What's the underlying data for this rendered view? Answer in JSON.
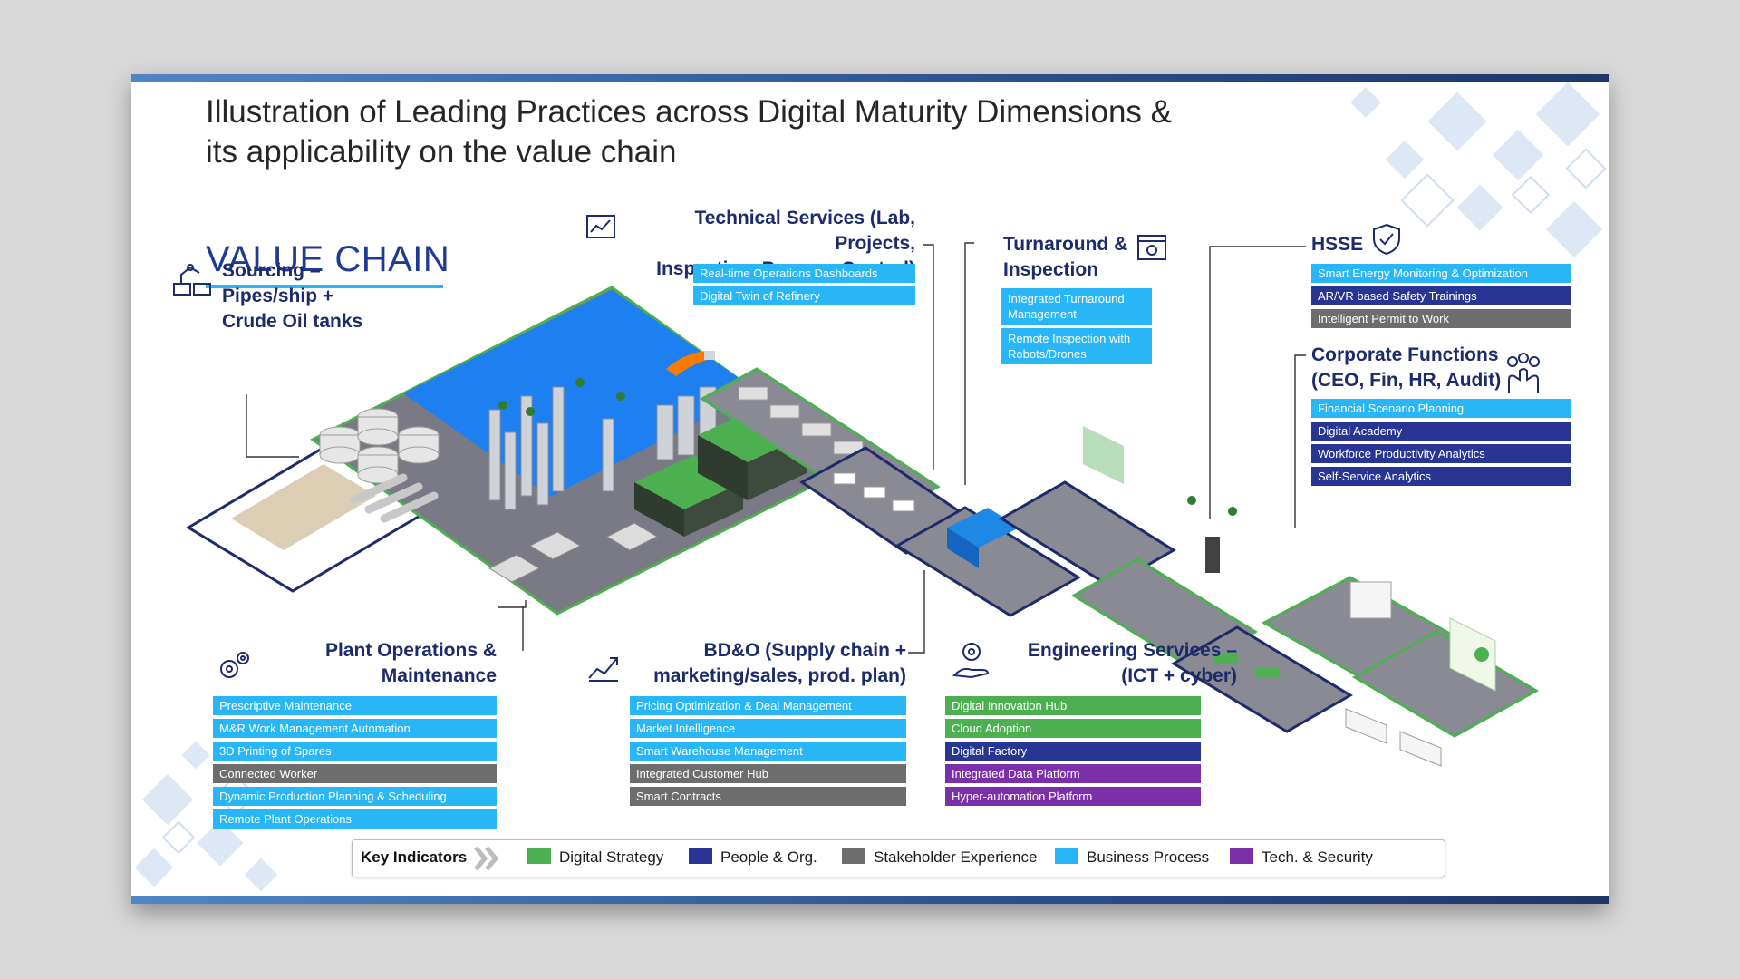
{
  "title_line1": "Illustration of Leading Practices across Digital Maturity Dimensions &",
  "title_line2": "its applicability on the value chain",
  "value_chain_label": "VALUE CHAIN",
  "colors": {
    "digital_strategy": "#4caf50",
    "people_org": "#283593",
    "stakeholder_experience": "#6d6d6d",
    "business_process": "#29b6f6",
    "tech_security": "#7b2fa8",
    "heading": "#1c2b6b"
  },
  "sections": {
    "sourcing": {
      "icon": "robot-arm-factory-icon",
      "title": [
        "Sourcing –",
        "Pipes/ship +",
        "Crude Oil tanks"
      ]
    },
    "technical": {
      "icon": "dashboard-report-icon",
      "title": [
        "Technical Services (Lab, Projects,",
        "Inspection, Process Control)"
      ],
      "items": [
        {
          "label": "Real-time Operations Dashboards",
          "category": "business_process"
        },
        {
          "label": "Digital Twin of Refinery",
          "category": "business_process"
        }
      ]
    },
    "turnaround": {
      "icon": "calendar-gear-icon",
      "title": [
        "Turnaround &",
        "Inspection"
      ],
      "items": [
        {
          "label": "Integrated Turnaround Management",
          "category": "business_process"
        },
        {
          "label": "Remote Inspection with Robots/Drones",
          "category": "business_process"
        }
      ]
    },
    "hsse": {
      "icon": "shield-check-icon",
      "title": [
        "HSSE"
      ],
      "items": [
        {
          "label": "Smart Energy Monitoring & Optimization",
          "category": "business_process"
        },
        {
          "label": "AR/VR based Safety Trainings",
          "category": "people_org"
        },
        {
          "label": "Intelligent Permit to Work",
          "category": "stakeholder_experience"
        }
      ]
    },
    "corporate": {
      "icon": "network-hand-icon",
      "title": [
        "Corporate Functions",
        "(CEO, Fin, HR, Audit)"
      ],
      "items": [
        {
          "label": "Financial Scenario Planning",
          "category": "business_process"
        },
        {
          "label": "Digital Academy",
          "category": "people_org"
        },
        {
          "label": "Workforce Productivity Analytics",
          "category": "people_org"
        },
        {
          "label": "Self-Service Analytics",
          "category": "people_org"
        }
      ]
    },
    "plant": {
      "icon": "gears-icon",
      "title": [
        "Plant Operations &",
        "Maintenance"
      ],
      "items": [
        {
          "label": "Prescriptive Maintenance",
          "category": "business_process"
        },
        {
          "label": "M&R Work Management Automation",
          "category": "business_process"
        },
        {
          "label": "3D Printing of Spares",
          "category": "business_process"
        },
        {
          "label": "Connected Worker",
          "category": "stakeholder_experience"
        },
        {
          "label": "Dynamic Production Planning & Scheduling",
          "category": "business_process"
        },
        {
          "label": "Remote Plant Operations",
          "category": "business_process"
        }
      ]
    },
    "bdo": {
      "icon": "growth-chart-icon",
      "title": [
        "BD&O (Supply chain +",
        "marketing/sales, prod. plan)"
      ],
      "items": [
        {
          "label": "Pricing Optimization & Deal Management",
          "category": "business_process"
        },
        {
          "label": "Market Intelligence",
          "category": "business_process"
        },
        {
          "label": "Smart Warehouse Management",
          "category": "business_process"
        },
        {
          "label": "Integrated Customer Hub",
          "category": "stakeholder_experience"
        },
        {
          "label": "Smart Contracts",
          "category": "stakeholder_experience"
        }
      ]
    },
    "engineering": {
      "icon": "gear-hand-icon",
      "title": [
        "Engineering Services –",
        "(ICT + cyber)"
      ],
      "items": [
        {
          "label": "Digital Innovation Hub",
          "category": "digital_strategy"
        },
        {
          "label": "Cloud Adoption",
          "category": "digital_strategy"
        },
        {
          "label": "Digital Factory",
          "category": "people_org"
        },
        {
          "label": "Integrated Data Platform",
          "category": "tech_security"
        },
        {
          "label": "Hyper-automation Platform",
          "category": "tech_security"
        }
      ]
    }
  },
  "legend": {
    "title": "Key Indicators",
    "icon": "double-chevron-icon",
    "items": [
      {
        "label": "Digital Strategy",
        "category": "digital_strategy"
      },
      {
        "label": "People & Org.",
        "category": "people_org"
      },
      {
        "label": "Stakeholder Experience",
        "category": "stakeholder_experience"
      },
      {
        "label": "Business Process",
        "category": "business_process"
      },
      {
        "label": "Tech. & Security",
        "category": "tech_security"
      }
    ]
  }
}
